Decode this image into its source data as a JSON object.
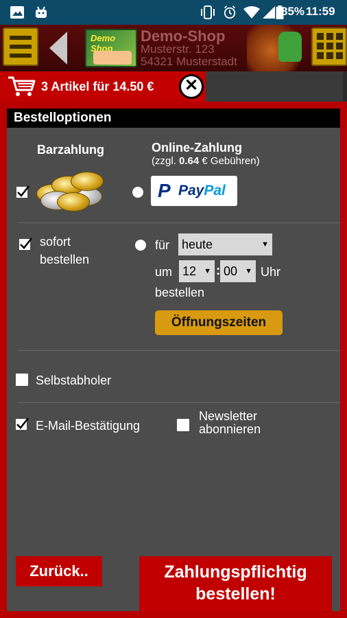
{
  "status_bar": {
    "battery_percent": "85%",
    "time": "11:59",
    "icons": [
      "image-icon",
      "android-icon",
      "vibrate-icon",
      "alarm-icon",
      "wifi-icon",
      "signal-icon",
      "battery-icon"
    ]
  },
  "header": {
    "shop_logo_text": "Demo Shop",
    "shop_name": "Demo-Shop",
    "street": "Musterstr. 123",
    "city": "54321 Musterstadt"
  },
  "cart": {
    "summary": "3 Artikel für 14.50 €"
  },
  "order_options": {
    "title": "Bestelloptionen",
    "payment": {
      "cash_label": "Barzahlung",
      "online_label": "Online-Zahlung",
      "fee_prefix": "(zzgl. ",
      "fee_amount": "0.64",
      "fee_suffix": " € Gebühren)",
      "paypal_p": "P",
      "paypal_pay": "Pay",
      "paypal_pal": "Pal"
    },
    "timing": {
      "immediate_line1": "sofort",
      "immediate_line2": "bestellen",
      "for_label": "für",
      "day_value": "heute",
      "at_label": "um",
      "hour_value": "12",
      "colon": ":",
      "minute_value": "00",
      "uhr_label": "Uhr",
      "order_label": "bestellen",
      "opening_hours_button": "Öffnungszeiten"
    },
    "pickup_label": "Selbstabholer",
    "email_confirm_label": "E-Mail-Bestätigung",
    "newsletter_line1": "Newsletter",
    "newsletter_line2": "abonnieren"
  },
  "footer": {
    "back_button": "Zurück..",
    "order_line1": "Zahlungspflichtig",
    "order_line2": "bestellen!"
  },
  "colors": {
    "status_bar": "#0d4a68",
    "accent_red": "#c00000",
    "panel_bg": "#4c4c4c",
    "button_gold": "#d89a10",
    "menu_gold": "#c9a000"
  }
}
